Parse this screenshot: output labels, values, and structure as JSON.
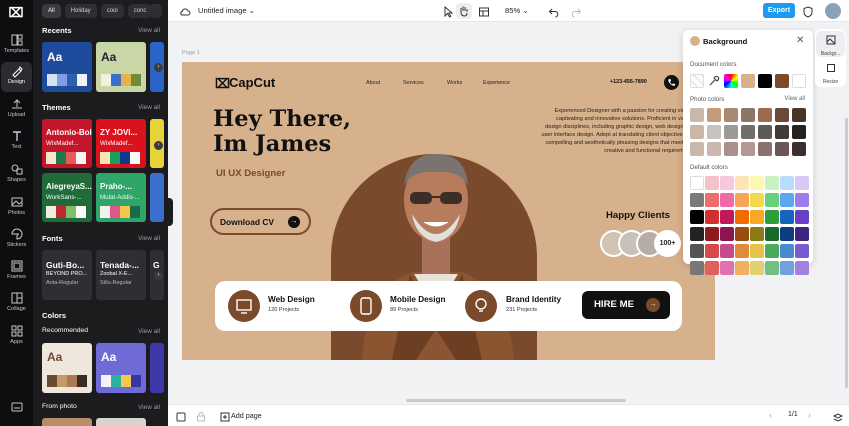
{
  "app": {
    "doc_title": "Untitled image",
    "zoom": "85%",
    "export_label": "Export",
    "page_label": "Page 1",
    "page_counter": "1/1",
    "add_page_label": "Add page"
  },
  "rail": {
    "items": [
      {
        "label": "Templates",
        "icon": "template-icon"
      },
      {
        "label": "Design",
        "icon": "design-icon"
      },
      {
        "label": "Upload",
        "icon": "upload-icon"
      },
      {
        "label": "Text",
        "icon": "text-icon"
      },
      {
        "label": "Shapes",
        "icon": "shapes-icon"
      },
      {
        "label": "Photos",
        "icon": "photos-icon"
      },
      {
        "label": "Stickers",
        "icon": "stickers-icon"
      },
      {
        "label": "Frames",
        "icon": "frames-icon"
      },
      {
        "label": "Collage",
        "icon": "collage-icon"
      },
      {
        "label": "Apps",
        "icon": "apps-icon"
      }
    ]
  },
  "panel": {
    "chips": [
      "All",
      "Holiday",
      "cool",
      "conc"
    ],
    "sections": {
      "recents": "Recents",
      "themes": "Themes",
      "fonts": "Fonts",
      "colors": "Colors",
      "recommended": "Recommended",
      "from_photo": "From photo"
    },
    "view_all": "View all",
    "themes": [
      {
        "title": "Antonio-Bold",
        "sub": "WixMadef..."
      },
      {
        "title": "ZY JOVI...",
        "sub": "WixMadef..."
      },
      {
        "title": "AlegreyaS...",
        "sub": "WorkSans-..."
      },
      {
        "title": "Praho-...",
        "sub": "Mulat-Addis-..."
      }
    ],
    "fonts": [
      {
        "title": "Guti-Bo...",
        "line2": "BEYOND PRO...",
        "sub": "Anta-Regular"
      },
      {
        "title": "Tenada-...",
        "line2": "Zoobal X-E...",
        "sub": "Stilu-Regular"
      },
      {
        "title": "G",
        "line2": "",
        "sub": ""
      }
    ]
  },
  "design": {
    "brand": "CapCut",
    "nav": [
      "About",
      "Services",
      "Works",
      "Experience"
    ],
    "phone": "+123-456-7890",
    "headline_line1": "Hey There,",
    "headline_line2": "Im James",
    "subhead": "UI UX Designer",
    "cv_button": "Download CV",
    "intro": "Experienced Designer with a passion for creating visually captivating and innovative solutions. Proficient in various design disciplines, including graphic design, web design, and user interface design. Adept at translating client objectives into compelling and aesthetically pleasing designs that meet both creative and functional requirements.",
    "happy_clients": "Happy Clients",
    "client_count": "100+",
    "services": [
      {
        "name": "Web Design",
        "sub": "120 Projects",
        "icon": "monitor-icon"
      },
      {
        "name": "Mobile Design",
        "sub": "89 Projects",
        "icon": "phone-icon"
      },
      {
        "name": "Brand Identity",
        "sub": "231 Projects",
        "icon": "bulb-icon"
      }
    ],
    "hire_button": "HIRE ME",
    "colors": {
      "background": "#d7b08c",
      "accent": "#7b4a2b",
      "dark": "#111111"
    }
  },
  "popover": {
    "title": "Background",
    "document_colors": "Document colors",
    "photo_colors": "Photo colors",
    "view_all": "View all",
    "default_colors": "Default colors",
    "doc_swatches": [
      "#d7b08c",
      "#000000",
      "#7b4a2b",
      "#ffffff"
    ],
    "photo_swatches": [
      [
        "#c49a78",
        "#a8896f",
        "#8a7765",
        "#9c6a4c",
        "#6a4a39",
        "#4a3428"
      ],
      [
        "#c5c3bf",
        "#9b9a95",
        "#6f6f6b",
        "#5e5a55",
        "#3e3b38",
        "#222220"
      ],
      [
        "#cbb7b1",
        "#a9908a",
        "#b49694",
        "#8b7070",
        "#6d5656",
        "#3b2f2f"
      ]
    ],
    "default_swatches": [
      [
        "#ffffff",
        "#f6c1c7",
        "#f9c6e0",
        "#fde3b8",
        "#fff6b3",
        "#c9f2c2",
        "#b9dcfb",
        "#d9c8f7"
      ],
      [
        "#7a7a7a",
        "#f06b6b",
        "#ef6aa9",
        "#f6a55b",
        "#f3d94e",
        "#66d07a",
        "#5aa9f0",
        "#9d7cf0"
      ],
      [
        "#000000",
        "#d32f2f",
        "#c2185b",
        "#ef6c00",
        "#f9a825",
        "#2e9e3a",
        "#1565c0",
        "#6a3fc7"
      ],
      [
        "#222222",
        "#8e1b1b",
        "#8a1550",
        "#9a4b10",
        "#8d7a12",
        "#1b6a2a",
        "#0d3d80",
        "#3c2480"
      ],
      [
        "#555555",
        "#d84a4a",
        "#c94a8a",
        "#e08a3a",
        "#e6c24a",
        "#4aaa5a",
        "#4a8ad0",
        "#7a5ad0"
      ],
      [
        "#777777",
        "#e06060",
        "#e070b0",
        "#f0b060",
        "#e0d070",
        "#70c080",
        "#70a0e0",
        "#a080e0"
      ]
    ]
  },
  "right_tabs": [
    {
      "label": "Backgr...",
      "icon": "background-icon"
    },
    {
      "label": "Resize",
      "icon": "resize-icon"
    }
  ]
}
